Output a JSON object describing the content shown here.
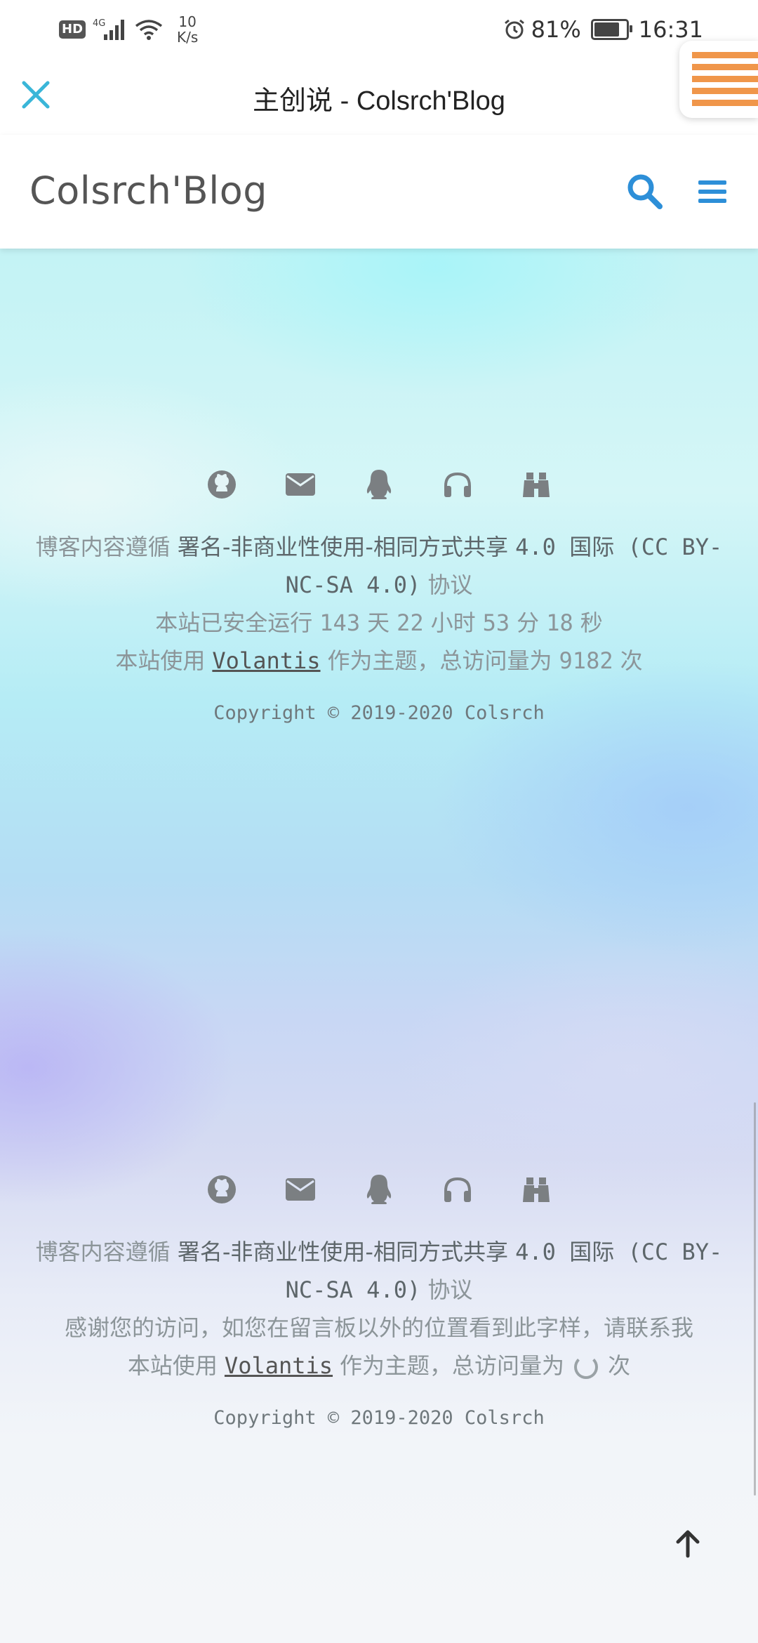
{
  "status_bar": {
    "hd": "HD",
    "signal": "4G",
    "net_speed_value": "10",
    "net_speed_unit": "K/s",
    "battery": "81%",
    "battery_level": 0.81,
    "time": "16:31"
  },
  "browser": {
    "title": "主创说 - Colsrch'Blog",
    "accent": "#3ab6d8"
  },
  "site": {
    "logo": "Colsrch'Blog",
    "icon_color": "#2d8fd8"
  },
  "footer1": {
    "social_icons": [
      "github-icon",
      "email-icon",
      "qq-icon",
      "headphones-icon",
      "binoculars-icon"
    ],
    "license_prefix": "博客内容遵循",
    "license_name_cn": "署名-非商业性使用-相同方式共享",
    "license_name_rest": "4.0 国际 (CC BY-NC-SA 4.0)",
    "license_suffix": "协议",
    "uptime_prefix": "本站已安全运行",
    "uptime_days": "143",
    "uptime_days_unit": "天",
    "uptime_hours": "22",
    "uptime_hours_unit": "小时",
    "uptime_minutes": "53",
    "uptime_minutes_unit": "分",
    "uptime_seconds": "18",
    "uptime_seconds_unit": "秒",
    "theme_prefix": "本站使用",
    "theme_link": "Volantis",
    "theme_middle": "作为主题，总访问量为",
    "visits": "9182",
    "visits_unit": "次",
    "copyright": "Copyright © 2019-2020 Colsrch"
  },
  "footer2": {
    "license_prefix": "博客内容遵循",
    "license_name_cn": "署名-非商业性使用-相同方式共享",
    "license_name_rest": "4.0 国际 (CC BY-NC-SA 4.0)",
    "license_suffix": "协议",
    "thanks": "感谢您的访问，如您在留言板以外的位置看到此字样，请联系我",
    "theme_prefix": "本站使用",
    "theme_link": "Volantis",
    "theme_middle": "作为主题，总访问量为",
    "visits_unit": "次",
    "copyright": "Copyright © 2019-2020 Colsrch"
  }
}
